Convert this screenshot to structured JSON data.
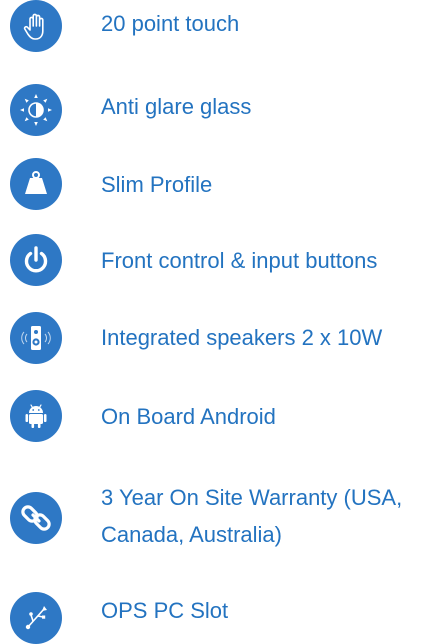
{
  "theme": {
    "accent": "#2e78c5",
    "text_color": "#2373c0",
    "background": "#ffffff"
  },
  "features": [
    {
      "label": "20 point touch",
      "icon": "hand-icon"
    },
    {
      "label": "Anti glare glass",
      "icon": "sun-icon"
    },
    {
      "label": "Slim Profile",
      "icon": "weight-icon"
    },
    {
      "label": "Front control & input buttons",
      "icon": "power-icon"
    },
    {
      "label": "Integrated speakers 2 x 10W",
      "icon": "speaker-icon"
    },
    {
      "label": "On Board Android",
      "icon": "android-icon"
    },
    {
      "label": "3 Year On Site Warranty (USA, Canada, Australia)",
      "icon": "link-icon"
    },
    {
      "label": "OPS PC Slot",
      "icon": "usb-icon"
    }
  ]
}
